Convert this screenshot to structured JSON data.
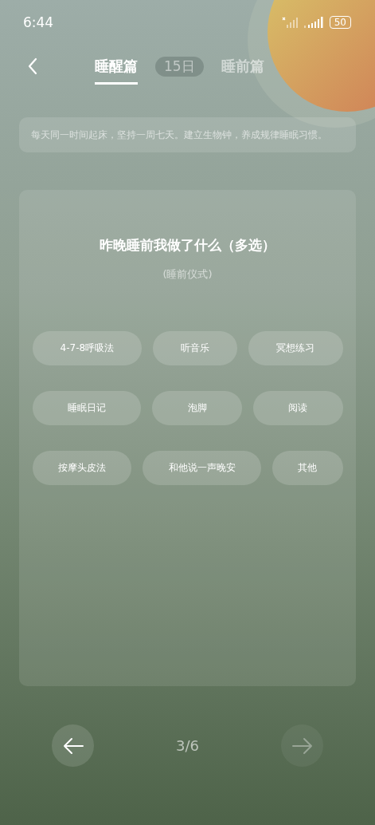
{
  "status_bar": {
    "time": "6:44",
    "battery": "50"
  },
  "header": {
    "tabs": [
      {
        "label": "睡醒篇",
        "selected": true
      },
      {
        "label": "睡前篇",
        "selected": false
      }
    ],
    "day_badge": "15日"
  },
  "tip": "每天同一时间起床，坚持一周七天。建立生物钟，养成规律睡眠习惯。",
  "question": {
    "title": "昨晚睡前我做了什么（多选）",
    "subtitle": "(睡前仪式)",
    "option_rows": [
      [
        {
          "label": "4-7-8呼吸法",
          "selected": false
        },
        {
          "label": "听音乐",
          "selected": false
        },
        {
          "label": "冥想练习",
          "selected": false
        }
      ],
      [
        {
          "label": "睡眠日记",
          "selected": false
        },
        {
          "label": "泡脚",
          "selected": false
        },
        {
          "label": "阅读",
          "selected": false
        }
      ],
      [
        {
          "label": "按摩头皮法",
          "selected": false
        },
        {
          "label": "和他说一声晚安",
          "selected": false
        },
        {
          "label": "其他",
          "selected": false
        }
      ]
    ]
  },
  "pager": {
    "progress": "3/6",
    "previous": {
      "disabled": false
    },
    "next": {
      "disabled": true
    }
  }
}
